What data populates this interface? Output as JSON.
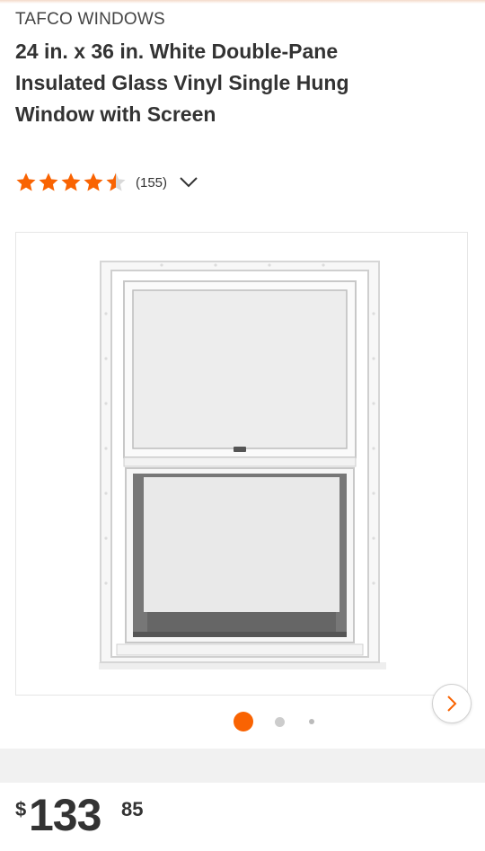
{
  "product": {
    "brand": "TAFCO WINDOWS",
    "title": "24 in. x 36 in. White Double-Pane Insulated Glass Vinyl Single Hung Window with Screen",
    "rating": 4.5,
    "rating_max": 5,
    "review_count": "(155)"
  },
  "gallery": {
    "image_alt": "White vinyl single hung window",
    "active_index": 0,
    "total_dots": 3
  },
  "price": {
    "currency": "$",
    "dollars": "133",
    "cents": "85"
  },
  "colors": {
    "accent": "#f96302",
    "text": "#333333",
    "dot_inactive": "#cccccc"
  },
  "icons": {
    "star": "star-icon",
    "chevron_down": "chevron-down-icon",
    "chevron_right": "chevron-right-icon"
  }
}
